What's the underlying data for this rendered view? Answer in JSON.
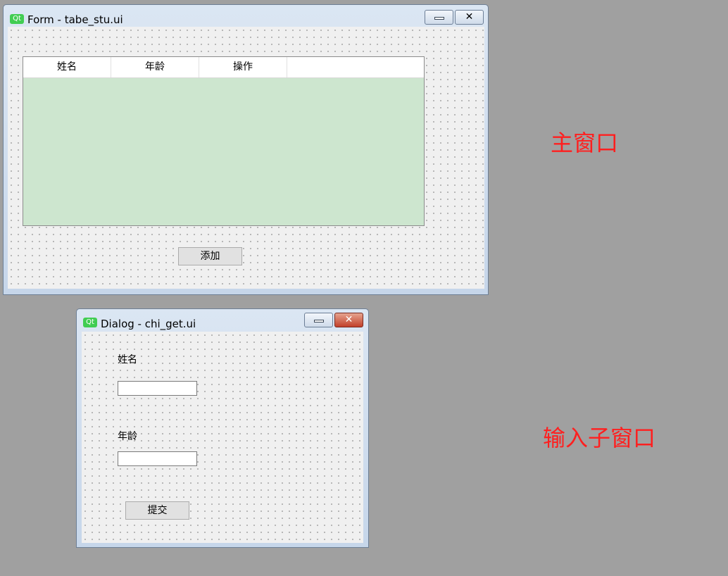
{
  "form_window": {
    "title": "Form - tabe_stu.ui",
    "logo": "Qt",
    "table": {
      "headers": [
        "姓名",
        "年龄",
        "操作"
      ],
      "body_color": "#cde6cf"
    },
    "add_button": "添加"
  },
  "dialog_window": {
    "title": "Dialog - chi_get.ui",
    "logo": "Qt",
    "name_label": "姓名",
    "name_value": "",
    "age_label": "年龄",
    "age_value": "",
    "submit_button": "提交"
  },
  "annotations": {
    "main_window": "主窗口",
    "input_subwindow": "输入子窗口"
  },
  "icons": {
    "minimize": "minimize-icon",
    "close": "close-icon"
  },
  "colors": {
    "annotation": "#ff1f1f",
    "background": "#a0a0a0",
    "table_body": "#cde6cf",
    "qt_logo": "#41cd52"
  }
}
